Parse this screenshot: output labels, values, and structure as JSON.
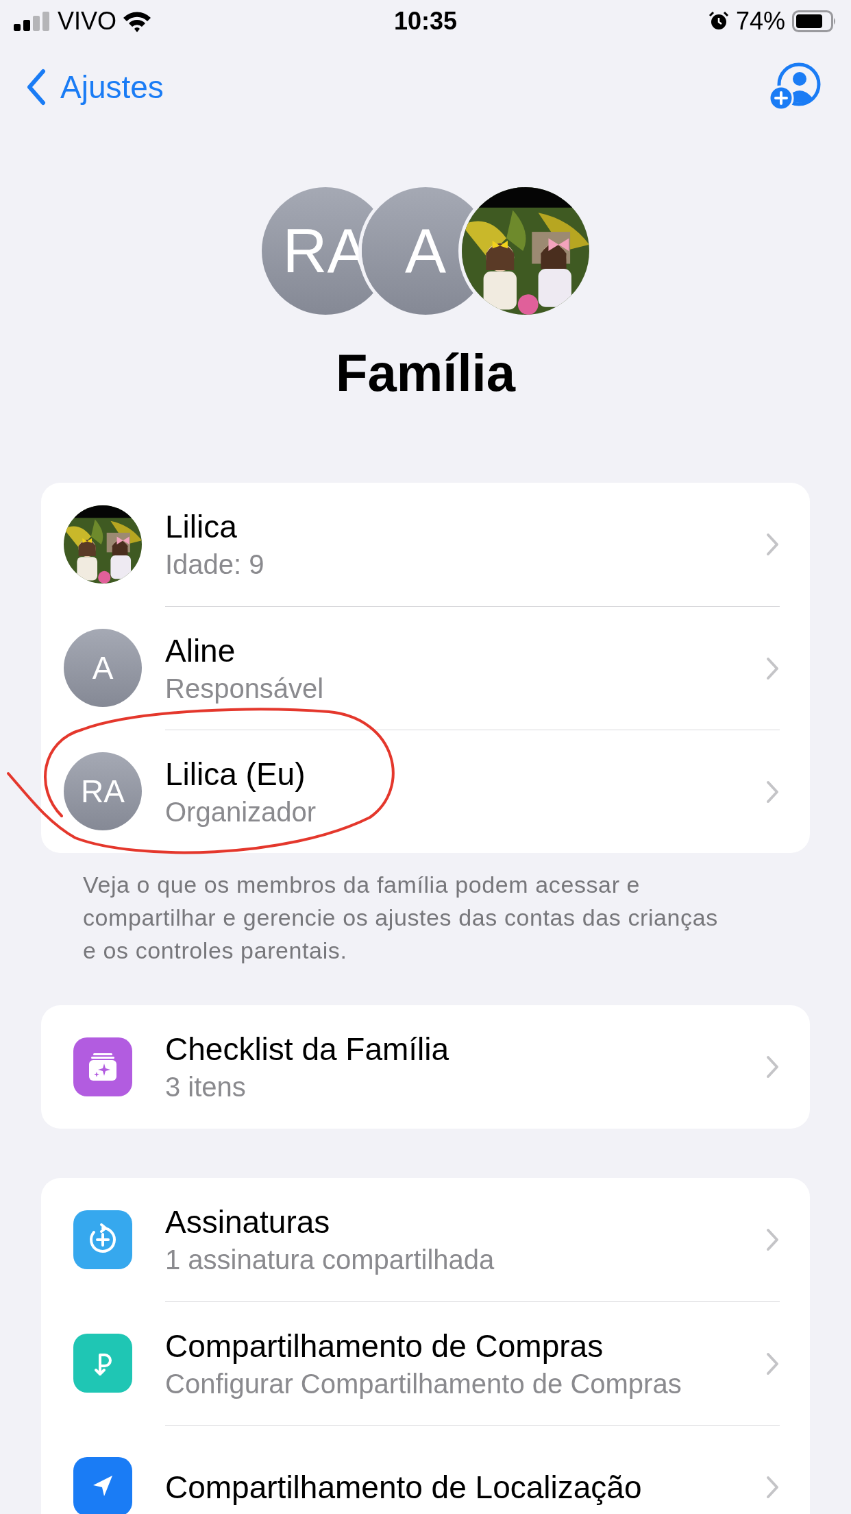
{
  "status_bar": {
    "carrier": "VIVO",
    "time": "10:35",
    "battery": "74%"
  },
  "nav": {
    "back": "Ajustes"
  },
  "header": {
    "avatars": [
      {
        "kind": "initials",
        "initials": "RA"
      },
      {
        "kind": "initials",
        "initials": "A"
      },
      {
        "kind": "picture"
      }
    ],
    "title": "Família"
  },
  "members": [
    {
      "avatar": {
        "kind": "picture"
      },
      "name": "Lilica",
      "detail": "Idade: 9"
    },
    {
      "avatar": {
        "kind": "initials",
        "initials": "A"
      },
      "name": "Aline",
      "detail": "Responsável"
    },
    {
      "avatar": {
        "kind": "initials",
        "initials": "RA"
      },
      "name": "Lilica (Eu)",
      "detail": "Organizador"
    }
  ],
  "members_note": "Veja o que os membros da família podem acessar e compartilhar e gerencie os ajustes das contas das crianças e os controles parentais.",
  "sections": [
    {
      "items": [
        {
          "kind": "checklist",
          "title": "Checklist da Família",
          "subtitle": "3 itens"
        }
      ]
    },
    {
      "items": [
        {
          "kind": "subscriptions",
          "title": "Assinaturas",
          "subtitle": "1 assinatura compartilhada"
        },
        {
          "kind": "purchases",
          "title": "Compartilhamento de Compras",
          "subtitle": "Configurar Compartilhamento de Compras"
        },
        {
          "kind": "location",
          "title": "Compartilhamento de Localização"
        }
      ]
    }
  ]
}
